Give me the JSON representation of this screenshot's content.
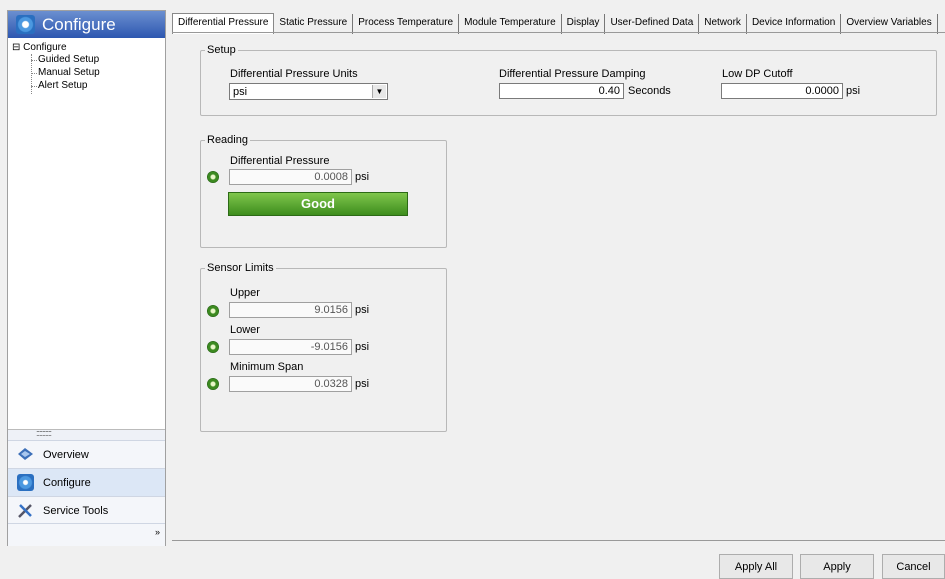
{
  "left_pane": {
    "title": "Configure",
    "tree": {
      "root": "Configure",
      "items": [
        "Guided Setup",
        "Manual Setup",
        "Alert Setup"
      ]
    },
    "splitter_grip": "::::::::::",
    "nav": [
      {
        "label": "Overview",
        "icon": "overview-icon"
      },
      {
        "label": "Configure",
        "icon": "gear-icon",
        "selected": true
      },
      {
        "label": "Service Tools",
        "icon": "tools-icon"
      }
    ],
    "more_glyph": "»"
  },
  "tabs": [
    "Differential Pressure",
    "Static Pressure",
    "Process Temperature",
    "Module Temperature",
    "Display",
    "User-Defined Data",
    "Network",
    "Device Information",
    "Overview Variables"
  ],
  "setup": {
    "legend": "Setup",
    "dp_units_label": "Differential Pressure Units",
    "dp_units_value": "psi",
    "damping_label": "Differential Pressure Damping",
    "damping_value": "0.40",
    "damping_unit": "Seconds",
    "cutoff_label": "Low DP Cutoff",
    "cutoff_value": "0.0000",
    "cutoff_unit": "psi"
  },
  "reading": {
    "legend": "Reading",
    "dp_label": "Differential Pressure",
    "dp_value": "0.0008",
    "dp_unit": "psi",
    "status": "Good",
    "status_color": "#5aa832"
  },
  "sensor_limits": {
    "legend": "Sensor Limits",
    "upper_label": "Upper",
    "upper_value": "9.0156",
    "upper_unit": "psi",
    "lower_label": "Lower",
    "lower_value": "-9.0156",
    "lower_unit": "psi",
    "span_label": "Minimum Span",
    "span_value": "0.0328",
    "span_unit": "psi"
  },
  "buttons": {
    "apply_all": "Apply All",
    "apply": "Apply",
    "cancel": "Cancel"
  }
}
